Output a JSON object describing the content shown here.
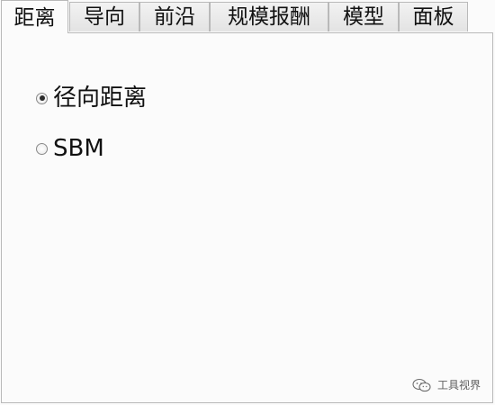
{
  "tabs": [
    {
      "label": "距离",
      "active": true
    },
    {
      "label": "导向",
      "active": false
    },
    {
      "label": "前沿",
      "active": false
    },
    {
      "label": "规模报酬",
      "active": false
    },
    {
      "label": "模型",
      "active": false
    },
    {
      "label": "面板",
      "active": false
    }
  ],
  "options": [
    {
      "label": "径向距离",
      "checked": true
    },
    {
      "label": "SBM",
      "checked": false
    }
  ],
  "watermark": {
    "text": "工具视界",
    "icon": "wechat-icon"
  }
}
